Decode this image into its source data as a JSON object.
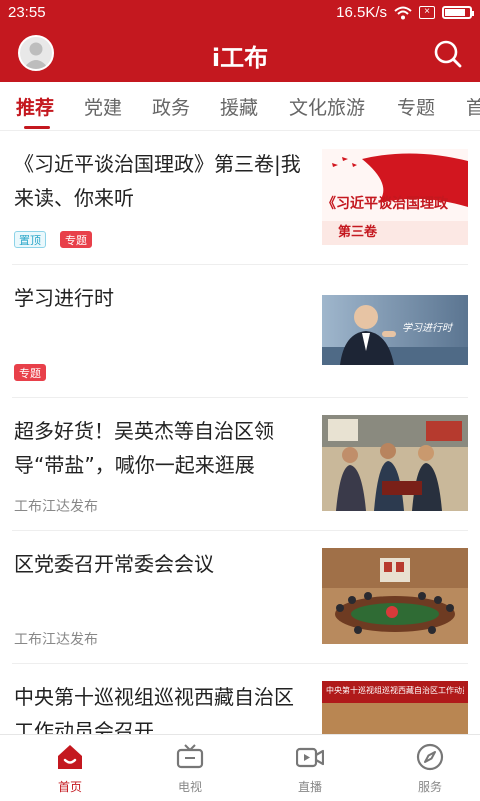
{
  "status_bar": {
    "time": "23:55",
    "net_speed": "16.5K/s",
    "battery_level": 0.85
  },
  "app": {
    "title": "i工布",
    "accent_color": "#c4181f"
  },
  "tabs": [
    {
      "label": "推荐",
      "active": true
    },
    {
      "label": "党建"
    },
    {
      "label": "政务"
    },
    {
      "label": "援藏"
    },
    {
      "label": "文化旅游"
    },
    {
      "label": "专题"
    },
    {
      "label": "首"
    }
  ],
  "feed": [
    {
      "headline": "《习近平谈治国理政》第三卷|我来读、你来听",
      "tags": [
        "置顶",
        "专题"
      ],
      "thumb": {
        "title": "《习近平谈治国理政",
        "subtitle": "第三卷"
      }
    },
    {
      "headline": "学习进行时",
      "tags": [
        "专题"
      ],
      "thumb": {
        "title": "学习进行时"
      }
    },
    {
      "headline": "超多好货！吴英杰等自治区领导“带盐”，喊你一起来逛展",
      "source": "工布江达发布"
    },
    {
      "headline": "区党委召开常委会会议",
      "source": "工布江达发布"
    },
    {
      "headline": "中央第十巡视组巡视西藏自治区工作动员会召开",
      "thumb": {
        "title": "中央第十巡视组巡视西藏自治区工作动员会议"
      }
    }
  ],
  "bottom_nav": [
    {
      "label": "首页",
      "icon": "home-icon",
      "active": true
    },
    {
      "label": "电视",
      "icon": "tv-icon"
    },
    {
      "label": "直播",
      "icon": "live-camera-icon"
    },
    {
      "label": "服务",
      "icon": "compass-icon"
    }
  ]
}
